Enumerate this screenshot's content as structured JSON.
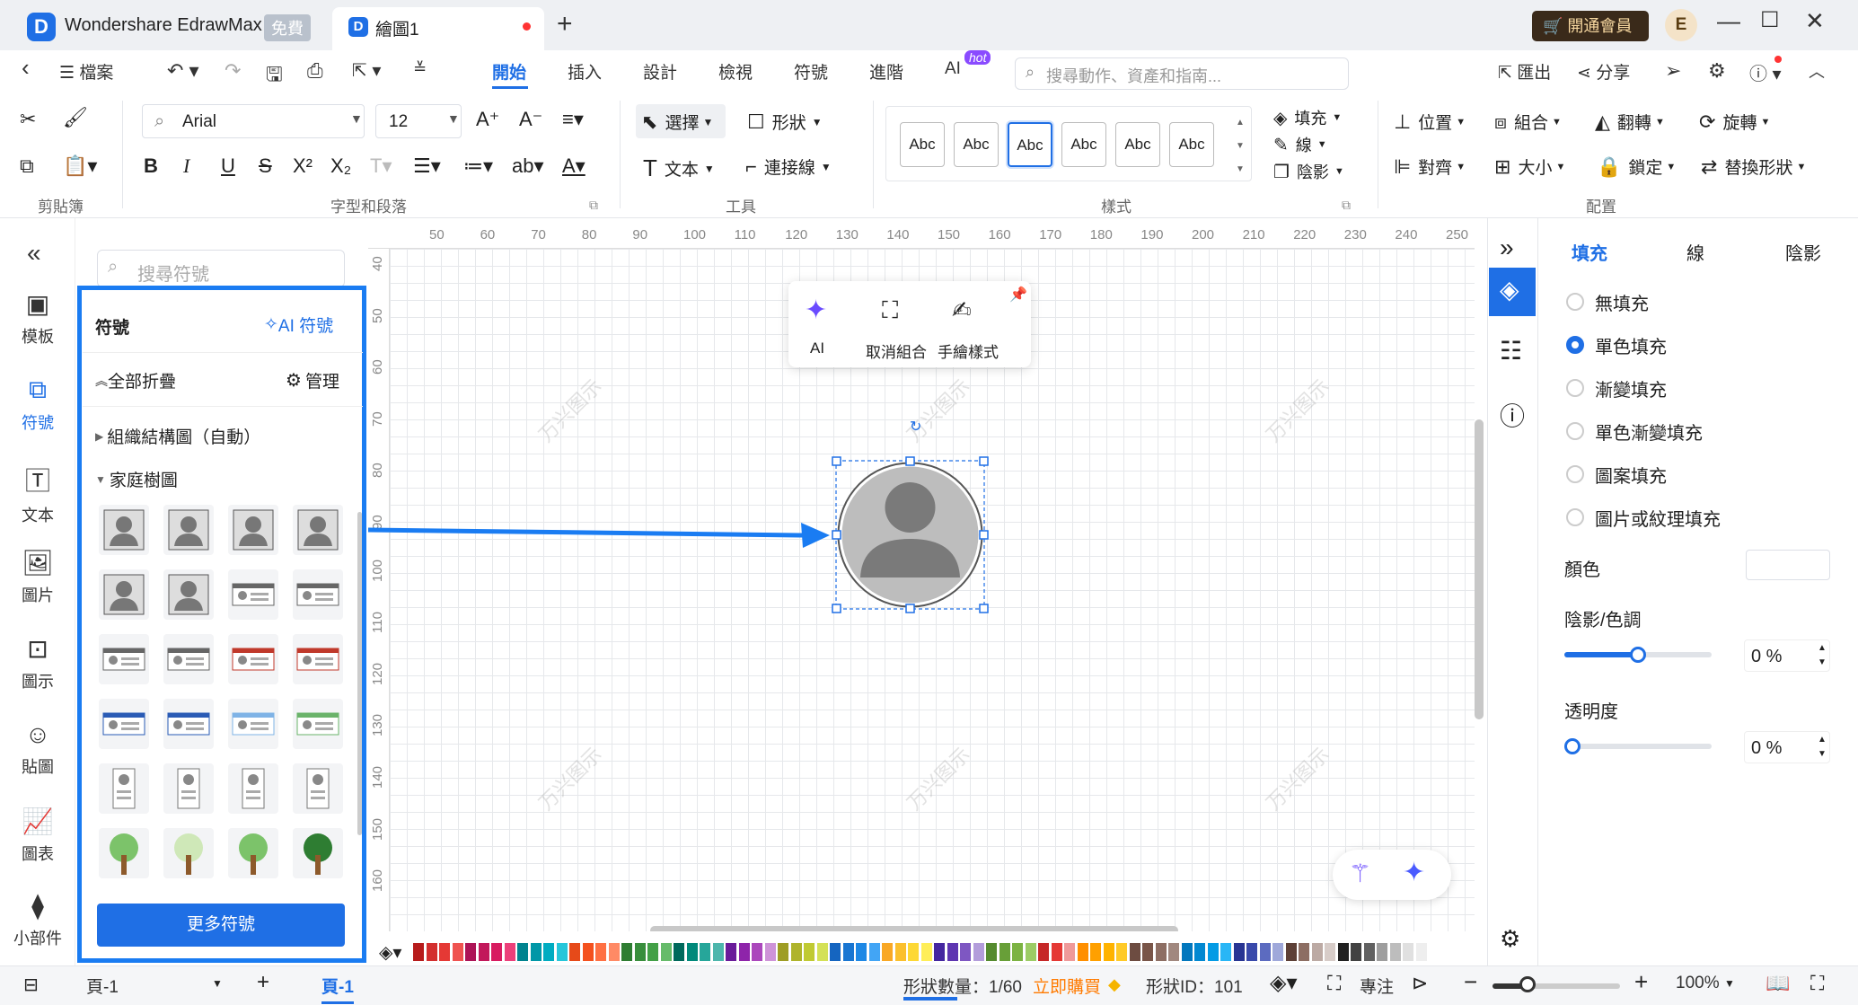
{
  "titlebar": {
    "app_name": "Wondershare EdrawMax",
    "free_badge": "免費",
    "doc_tab": "繪圖1",
    "vip": "開通會員",
    "user_initial": "E"
  },
  "menu": {
    "file": "檔案",
    "tabs": [
      "開始",
      "插入",
      "設計",
      "檢視",
      "符號",
      "進階",
      "AI"
    ],
    "hot": "hot",
    "search_placeholder": "搜尋動作、資產和指南...",
    "export": "匯出",
    "share": "分享"
  },
  "ribbon": {
    "clipboard_label": "剪貼簿",
    "font_label": "字型和段落",
    "tools_label": "工具",
    "styles_label": "樣式",
    "arrange_label": "配置",
    "font_name": "Arial",
    "font_size": "12",
    "select": "選擇",
    "shape": "形狀",
    "text": "文本",
    "connector": "連接線",
    "style_sample": "Abc",
    "fill": "填充",
    "line": "線",
    "shadow": "陰影",
    "position": "位置",
    "group": "組合",
    "flip": "翻轉",
    "rotate": "旋轉",
    "align": "對齊",
    "size": "大小",
    "lock": "鎖定",
    "replace": "替換形狀"
  },
  "rail": [
    {
      "label": "模板",
      "icon": "template-icon"
    },
    {
      "label": "符號",
      "icon": "symbol-icon"
    },
    {
      "label": "文本",
      "icon": "text-icon"
    },
    {
      "label": "圖片",
      "icon": "image-icon"
    },
    {
      "label": "圖示",
      "icon": "icon-library-icon"
    },
    {
      "label": "貼圖",
      "icon": "sticker-icon"
    },
    {
      "label": "圖表",
      "icon": "chart-icon"
    },
    {
      "label": "小部件",
      "icon": "widget-icon"
    }
  ],
  "library": {
    "search_placeholder": "搜尋符號",
    "title": "符號",
    "ai_symbols": "AI 符號",
    "collapse_all": "全部折疊",
    "manage": "管理",
    "cat_org": "組織結構圖（自動）",
    "cat_family": "家庭樹圖",
    "more": "更多符號"
  },
  "ruler_top": [
    "50",
    "60",
    "70",
    "80",
    "90",
    "100",
    "110",
    "120",
    "130",
    "140",
    "150",
    "160",
    "170",
    "180",
    "190",
    "200",
    "210",
    "220",
    "230",
    "240",
    "250"
  ],
  "ruler_left": [
    "40",
    "50",
    "60",
    "70",
    "80",
    "90",
    "100",
    "110",
    "120",
    "130",
    "140",
    "150",
    "160"
  ],
  "float_toolbar": {
    "ai": "AI",
    "ungroup": "取消組合",
    "handdrawn": "手繪樣式"
  },
  "watermark": "万兴图示",
  "right_panel": {
    "tabs": [
      "填充",
      "線",
      "陰影"
    ],
    "options": [
      "無填充",
      "單色填充",
      "漸變填充",
      "單色漸變填充",
      "圖案填充",
      "圖片或紋理填充"
    ],
    "selected_option": "單色填充",
    "color_label": "顏色",
    "shade_label": "陰影/色調",
    "shade_value": "0 %",
    "transparency_label": "透明度",
    "transparency_value": "0 %"
  },
  "status": {
    "page_name": "頁-1",
    "active_page": "頁-1",
    "shape_count": "形狀數量：1/60",
    "buy_now": "立即購買",
    "shape_id": "形狀ID：101",
    "focus": "專注",
    "zoom": "100%"
  },
  "colors": {
    "accent": "#1f6fe5",
    "highlight_border": "#1a7cf2"
  }
}
